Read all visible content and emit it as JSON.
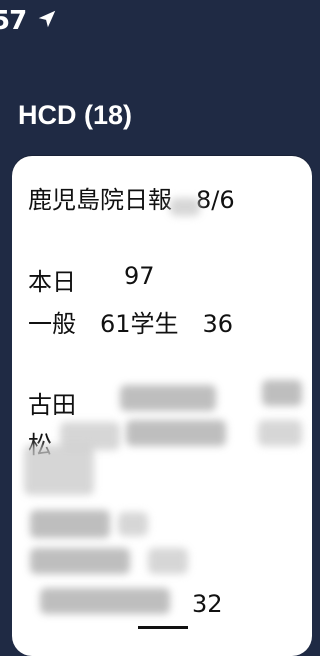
{
  "status_bar": {
    "time": "57",
    "location_icon": "location-arrow-icon"
  },
  "header": {
    "title": "HCD (18)"
  },
  "message": {
    "line1": "鹿児島院日報　8/6",
    "line_today_label": "本日",
    "line_today_value": "97",
    "line_general": "一般　61学生　36",
    "line_name_1": "古田",
    "line_name_2": "松",
    "line_end_value": "32"
  },
  "colors": {
    "header_bg": "#1f2a44",
    "card_bg": "#ffffff"
  }
}
